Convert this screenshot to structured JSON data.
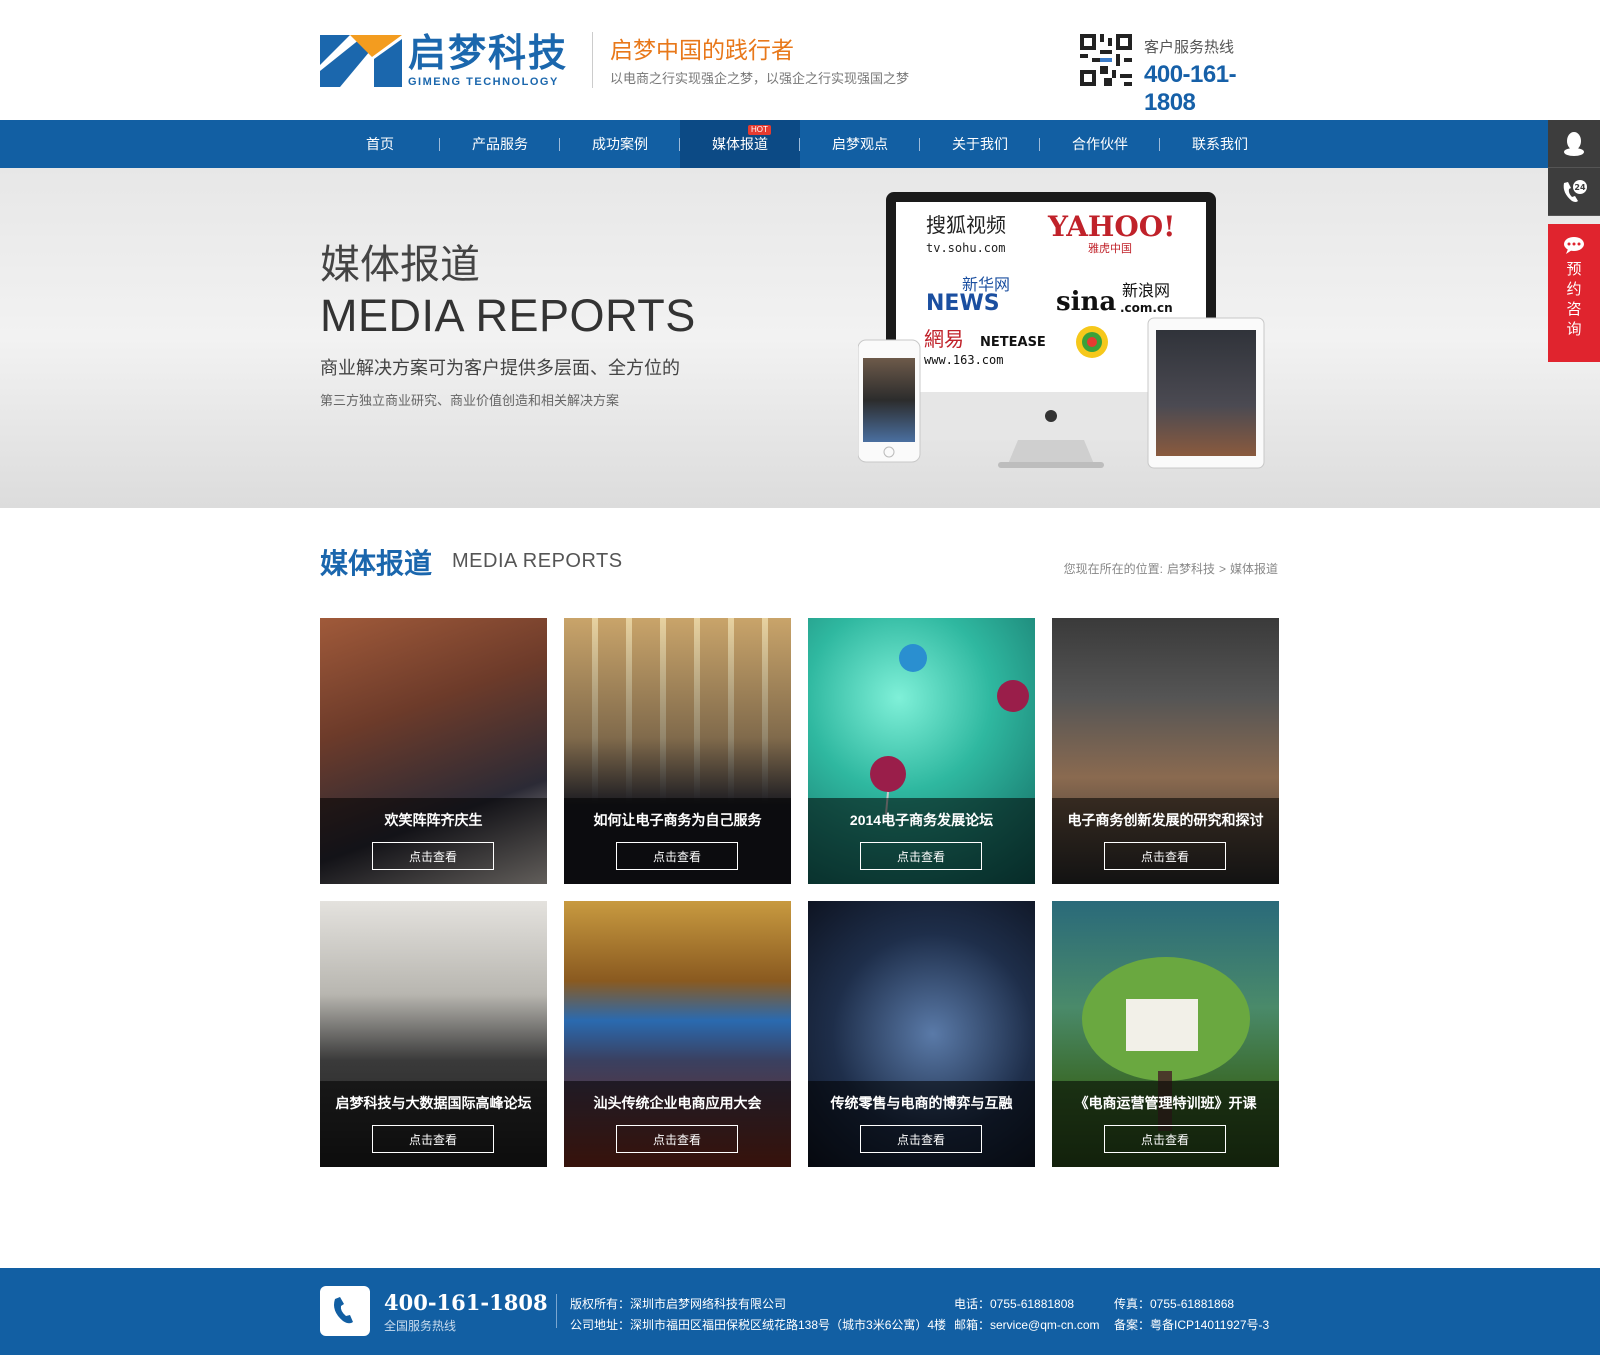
{
  "header": {
    "logo_cn": "启梦科技",
    "logo_en": "GIMENG TECHNOLOGY",
    "slogan_main": "启梦中国的践行者",
    "slogan_sub": "以电商之行实现强企之梦，以强企之行实现强国之梦",
    "hotline_label": "客户服务热线",
    "hotline_number": "400-161-1808"
  },
  "nav": {
    "items": [
      {
        "label": "首页"
      },
      {
        "label": "产品服务"
      },
      {
        "label": "成功案例"
      },
      {
        "label": "媒体报道",
        "badge": "HOT",
        "active": true
      },
      {
        "label": "启梦观点"
      },
      {
        "label": "关于我们"
      },
      {
        "label": "合作伙伴"
      },
      {
        "label": "联系我们"
      }
    ]
  },
  "banner": {
    "title_cn": "媒体报道",
    "title_en": "MEDIA REPORTS",
    "line1": "商业解决方案可为客户提供多层面、全方位的",
    "line2": "第三方独立商业研究、商业价值创造和相关解决方案",
    "screen_logos": [
      "搜狐视频",
      "tv.sohu.com",
      "YAHOO!",
      "雅虎中国",
      "新华网",
      "NEWS",
      "sina",
      "新浪网",
      ".com.cn",
      "網易",
      "NETEASE",
      "www.163.com"
    ]
  },
  "section": {
    "title_cn": "媒体报道",
    "title_en": "MEDIA REPORTS",
    "breadcrumb_prefix": "您现在所在的位置:",
    "breadcrumb_home": "启梦科技",
    "breadcrumb_sep": ">",
    "breadcrumb_current": "媒体报道"
  },
  "cards": [
    {
      "title": "欢笑阵阵齐庆生",
      "button": "点击查看"
    },
    {
      "title": "如何让电子商务为自己服务",
      "button": "点击查看"
    },
    {
      "title": "2014电子商务发展论坛",
      "button": "点击查看"
    },
    {
      "title": "电子商务创新发展的研究和探讨",
      "button": "点击查看"
    },
    {
      "title": "启梦科技与大数据国际高峰论坛",
      "button": "点击查看"
    },
    {
      "title": "汕头传统企业电商应用大会",
      "button": "点击查看"
    },
    {
      "title": "传统零售与电商的博弈与互融",
      "button": "点击查看"
    },
    {
      "title": "《电商运营管理特训班》开课",
      "button": "点击查看"
    }
  ],
  "footer": {
    "hotline_number": "400-161-1808",
    "hotline_label": "全国服务热线",
    "copyright": "版权所有：深圳市启梦网络科技有限公司",
    "address": "公司地址：深圳市福田区福田保税区绒花路138号（城市3米6公寓）4楼",
    "phone": "电话：0755-61881808",
    "email": "邮箱：service@qm-cn.com",
    "fax": "传真：0755-61881868",
    "icp": "备案：粤备ICP14011927号-3"
  },
  "side": {
    "book_label": [
      "预",
      "约",
      "咨",
      "询"
    ],
    "phone_badge": "24"
  },
  "colors": {
    "brand_blue": "#125fa3",
    "accent_orange": "#e8781a",
    "consult_red": "#e0242e"
  }
}
